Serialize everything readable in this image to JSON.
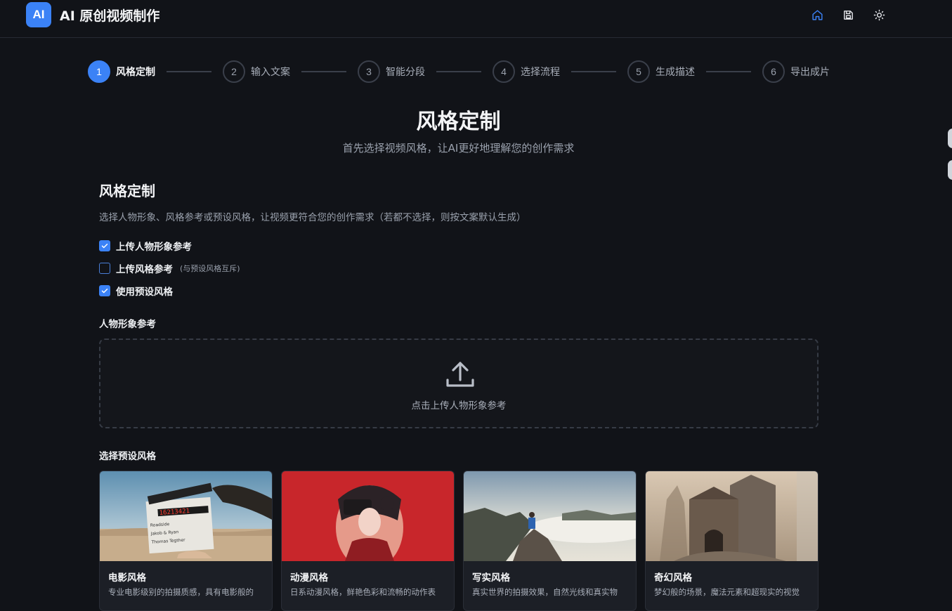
{
  "header": {
    "logo_text": "AI",
    "title": "AI 原创视频制作",
    "icons": [
      "home-icon",
      "save-icon",
      "sun-icon"
    ]
  },
  "stepper": [
    {
      "num": "1",
      "label": "风格定制",
      "active": true
    },
    {
      "num": "2",
      "label": "输入文案",
      "active": false
    },
    {
      "num": "3",
      "label": "智能分段",
      "active": false
    },
    {
      "num": "4",
      "label": "选择流程",
      "active": false
    },
    {
      "num": "5",
      "label": "生成描述",
      "active": false
    },
    {
      "num": "6",
      "label": "导出成片",
      "active": false
    }
  ],
  "page": {
    "title": "风格定制",
    "subtitle": "首先选择视频风格，让AI更好地理解您的创作需求"
  },
  "section": {
    "title": "风格定制",
    "description": "选择人物形象、风格参考或预设风格，让视频更符合您的创作需求（若都不选择，则按文案默认生成）"
  },
  "options": [
    {
      "label": "上传人物形象参考",
      "note": "",
      "checked": true
    },
    {
      "label": "上传风格参考",
      "note": "(与预设风格互斥)",
      "checked": false
    },
    {
      "label": "使用预设风格",
      "note": "",
      "checked": true
    }
  ],
  "character_ref": {
    "title": "人物形象参考",
    "upload_text": "点击上传人物形象参考"
  },
  "preset": {
    "title": "选择预设风格",
    "cards": [
      {
        "title": "电影风格",
        "desc": "专业电影级别的拍摄质感，具有电影般的"
      },
      {
        "title": "动漫风格",
        "desc": "日系动漫风格，鲜艳色彩和流畅的动作表"
      },
      {
        "title": "写实风格",
        "desc": "真实世界的拍摄效果，自然光线和真实物"
      },
      {
        "title": "奇幻风格",
        "desc": "梦幻般的场景，魔法元素和超现实的视觉"
      }
    ]
  },
  "colors": {
    "background": "#111318",
    "accent": "#3b82f6"
  },
  "clapper": {
    "timecode": "16213421",
    "slate_lines": [
      "Roadside",
      "Jakob & Ryan",
      "Thomas Tegther"
    ]
  }
}
